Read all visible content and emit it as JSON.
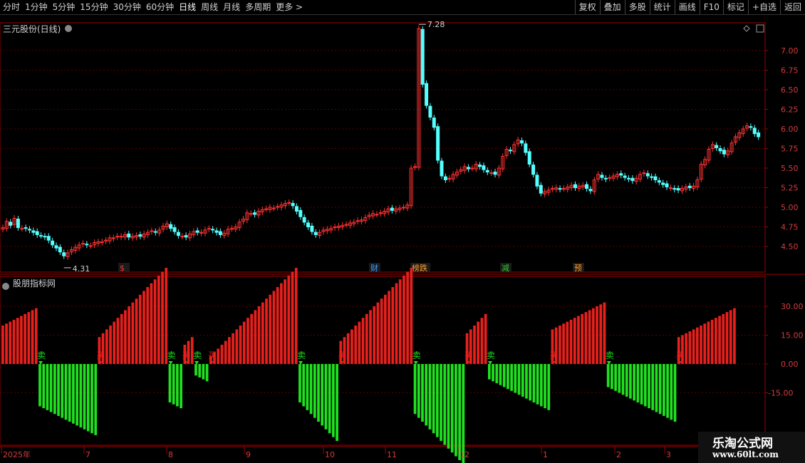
{
  "toolbar": {
    "periods": [
      "分时",
      "1分钟",
      "5分钟",
      "15分钟",
      "30分钟",
      "60分钟",
      "日线",
      "周线",
      "月线",
      "多周期",
      "更多 >"
    ],
    "active_index": 6,
    "right_buttons": [
      "复权",
      "叠加",
      "多股",
      "统计",
      "画线",
      "F10",
      "+自选",
      "返回"
    ],
    "extra_button": "标记"
  },
  "main_panel": {
    "title": "三元股份(日线)",
    "y_ticks": [
      "7.00",
      "6.75",
      "6.50",
      "6.25",
      "6.00",
      "5.75",
      "5.50",
      "5.25",
      "5.00",
      "4.75",
      "4.50"
    ],
    "high_label": "7.28",
    "low_label": "4.31",
    "event_markers": [
      {
        "text": "$",
        "color": "#ff3030"
      },
      {
        "text": "财",
        "color": "#3aa0ff"
      },
      {
        "text": "榜跌",
        "color": "#ff9d2e"
      },
      {
        "text": "减",
        "color": "#2ec82e"
      },
      {
        "text": "预",
        "color": "#ff9d2e"
      }
    ]
  },
  "indicator_panel": {
    "title": "股朋指标网",
    "y_ticks": [
      "30.00",
      "15.00",
      "0.00",
      "-15.00"
    ],
    "sell_label": "卖",
    "buy_label": "买"
  },
  "time_axis": [
    "2025年",
    "7",
    "8",
    "9",
    "10",
    "11",
    "12",
    "1",
    "2",
    "3"
  ],
  "watermark": {
    "line1": "乐淘公式网",
    "line2": "www.60lt.com"
  },
  "colors": {
    "up": "#ff3232",
    "down": "#54ffff",
    "bar_red": "#e8201c",
    "bar_green": "#1fe11f",
    "axis_red": "#a00000"
  },
  "chart_data": {
    "type": "candlestick",
    "ylim": [
      4.2,
      7.45
    ],
    "closes": [
      4.74,
      4.82,
      4.77,
      4.86,
      4.74,
      4.73,
      4.73,
      4.71,
      4.68,
      4.65,
      4.64,
      4.62,
      4.58,
      4.52,
      4.48,
      4.43,
      4.38,
      4.42,
      4.46,
      4.49,
      4.52,
      4.54,
      4.52,
      4.51,
      4.55,
      4.56,
      4.56,
      4.58,
      4.61,
      4.61,
      4.63,
      4.63,
      4.65,
      4.62,
      4.63,
      4.64,
      4.63,
      4.66,
      4.68,
      4.7,
      4.68,
      4.71,
      4.76,
      4.79,
      4.73,
      4.69,
      4.64,
      4.63,
      4.62,
      4.66,
      4.69,
      4.68,
      4.68,
      4.71,
      4.73,
      4.71,
      4.68,
      4.65,
      4.67,
      4.72,
      4.73,
      4.75,
      4.81,
      4.85,
      4.93,
      4.92,
      4.91,
      4.95,
      4.97,
      4.98,
      5.0,
      4.99,
      5.01,
      5.03,
      5.05,
      5.06,
      5.02,
      4.95,
      4.88,
      4.81,
      4.75,
      4.69,
      4.65,
      4.68,
      4.71,
      4.72,
      4.73,
      4.75,
      4.76,
      4.77,
      4.78,
      4.8,
      4.81,
      4.83,
      4.84,
      4.87,
      4.9,
      4.92,
      4.91,
      4.93,
      4.95,
      4.98,
      4.96,
      4.98,
      4.99,
      5.0,
      5.03,
      5.5,
      5.52,
      7.28,
      6.57,
      6.3,
      6.15,
      6.02,
      5.6,
      5.4,
      5.35,
      5.37,
      5.42,
      5.45,
      5.48,
      5.52,
      5.49,
      5.5,
      5.55,
      5.52,
      5.48,
      5.45,
      5.44,
      5.42,
      5.5,
      5.65,
      5.74,
      5.72,
      5.8,
      5.86,
      5.82,
      5.7,
      5.55,
      5.42,
      5.27,
      5.18,
      5.2,
      5.22,
      5.24,
      5.25,
      5.23,
      5.24,
      5.26,
      5.28,
      5.25,
      5.27,
      5.28,
      5.24,
      5.21,
      5.35,
      5.42,
      5.38,
      5.36,
      5.38,
      5.4,
      5.42,
      5.41,
      5.38,
      5.36,
      5.34,
      5.37,
      5.42,
      5.44,
      5.4,
      5.38,
      5.35,
      5.32,
      5.29,
      5.26,
      5.25,
      5.23,
      5.22,
      5.24,
      5.26,
      5.25,
      5.27,
      5.35,
      5.55,
      5.61,
      5.74,
      5.8,
      5.76,
      5.72,
      5.68,
      5.72,
      5.82,
      5.9,
      5.95,
      6.0,
      6.04,
      6.02,
      5.94,
      5.9
    ],
    "indicator": [
      20,
      21,
      22,
      23,
      24,
      25,
      26,
      27,
      28,
      29,
      -22,
      -23,
      -24,
      -25,
      -26,
      -27,
      -28,
      -29,
      -30,
      -31,
      -32,
      -33,
      -34,
      -35,
      -36,
      -37,
      14,
      16,
      18,
      20,
      22,
      24,
      26,
      28,
      30,
      32,
      34,
      36,
      38,
      40,
      42,
      44,
      46,
      48,
      50,
      -20,
      -21,
      -22,
      -23,
      10,
      12,
      14,
      -6,
      -7,
      -8,
      -9,
      4,
      6,
      8,
      10,
      12,
      14,
      16,
      18,
      20,
      22,
      24,
      26,
      28,
      30,
      32,
      34,
      36,
      38,
      40,
      42,
      44,
      46,
      48,
      50,
      -20,
      -22,
      -24,
      -26,
      -28,
      -30,
      -32,
      -34,
      -36,
      -38,
      -40,
      12,
      14,
      16,
      18,
      20,
      22,
      24,
      26,
      28,
      30,
      32,
      34,
      36,
      38,
      40,
      42,
      44,
      46,
      48,
      50,
      -26,
      -28,
      -30,
      -32,
      -34,
      -36,
      -38,
      -40,
      -42,
      -44,
      -46,
      -48,
      -50,
      -52,
      16,
      18,
      20,
      22,
      24,
      26,
      -8,
      -9,
      -10,
      -11,
      -12,
      -13,
      -14,
      -15,
      -16,
      -17,
      -18,
      -19,
      -20,
      -21,
      -22,
      -23,
      -24,
      18,
      19,
      20,
      21,
      22,
      23,
      24,
      25,
      26,
      27,
      28,
      29,
      30,
      31,
      32,
      -12,
      -13,
      -14,
      -15,
      -16,
      -17,
      -18,
      -19,
      -20,
      -21,
      -22,
      -23,
      -24,
      -25,
      -26,
      -27,
      -28,
      -29,
      -30,
      14,
      15,
      16,
      17,
      18,
      19,
      20,
      21,
      22,
      23,
      24,
      25,
      26,
      27,
      28,
      29
    ]
  }
}
